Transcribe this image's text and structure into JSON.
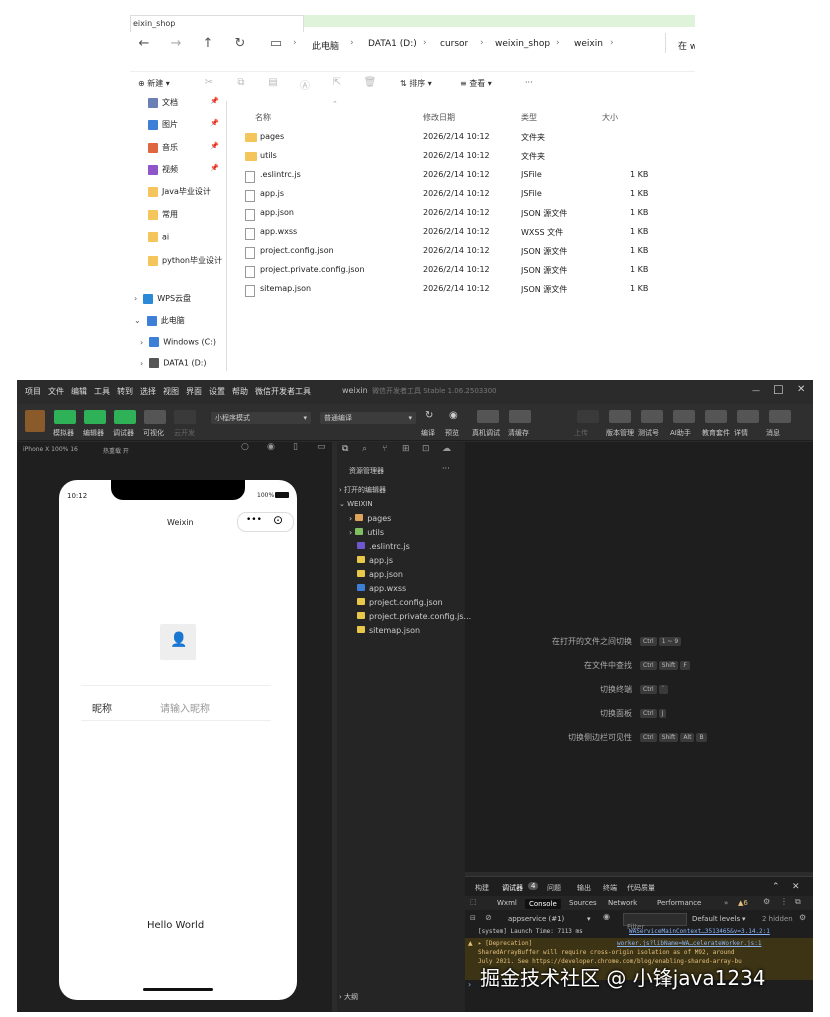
{
  "explorer": {
    "tab_title": "eixin_shop",
    "breadcrumb": [
      "此电脑",
      "DATA1 (D:)",
      "cursor",
      "weixin_shop",
      "weixin"
    ],
    "search_placeholder": "在 w",
    "toolbar": {
      "new": "新建",
      "sort": "排序",
      "view": "查看",
      "more": "···"
    },
    "sidebar": [
      {
        "label": "文档",
        "color": "#6a7fb5"
      },
      {
        "label": "图片",
        "color": "#3d7fd6"
      },
      {
        "label": "音乐",
        "color": "#e0663f"
      },
      {
        "label": "视频",
        "color": "#8f56c9"
      },
      {
        "label": "Java毕业设计",
        "color": "#f4c55b"
      },
      {
        "label": "常用",
        "color": "#f4c55b"
      },
      {
        "label": "ai",
        "color": "#f4c55b"
      },
      {
        "label": "python毕业设计",
        "color": "#f4c55b"
      }
    ],
    "tree": [
      {
        "label": "WPS云盘"
      },
      {
        "label": "此电脑"
      },
      {
        "label": "Windows (C:)"
      },
      {
        "label": "DATA1 (D:)"
      }
    ],
    "columns": [
      "名称",
      "修改日期",
      "类型",
      "大小"
    ],
    "files": [
      {
        "name": "pages",
        "date": "2026/2/14 10:12",
        "type": "文件夹",
        "size": "",
        "kind": "folder"
      },
      {
        "name": "utils",
        "date": "2026/2/14 10:12",
        "type": "文件夹",
        "size": "",
        "kind": "folder"
      },
      {
        "name": ".eslintrc.js",
        "date": "2026/2/14 10:12",
        "type": "JSFile",
        "size": "1 KB",
        "kind": "file"
      },
      {
        "name": "app.js",
        "date": "2026/2/14 10:12",
        "type": "JSFile",
        "size": "1 KB",
        "kind": "file"
      },
      {
        "name": "app.json",
        "date": "2026/2/14 10:12",
        "type": "JSON 源文件",
        "size": "1 KB",
        "kind": "file"
      },
      {
        "name": "app.wxss",
        "date": "2026/2/14 10:12",
        "type": "WXSS 文件",
        "size": "1 KB",
        "kind": "file"
      },
      {
        "name": "project.config.json",
        "date": "2026/2/14 10:12",
        "type": "JSON 源文件",
        "size": "1 KB",
        "kind": "file"
      },
      {
        "name": "project.private.config.json",
        "date": "2026/2/14 10:12",
        "type": "JSON 源文件",
        "size": "1 KB",
        "kind": "file"
      },
      {
        "name": "sitemap.json",
        "date": "2026/2/14 10:12",
        "type": "JSON 源文件",
        "size": "1 KB",
        "kind": "file"
      }
    ]
  },
  "ide": {
    "menu": [
      "项目",
      "文件",
      "编辑",
      "工具",
      "转到",
      "选择",
      "视图",
      "界面",
      "设置",
      "帮助",
      "微信开发者工具"
    ],
    "title": "weixin",
    "subtitle": "微信开发者工具 Stable 1.06.2503300",
    "toolbar_left": [
      "模拟器",
      "编辑器",
      "调试器",
      "可视化",
      "云开发"
    ],
    "mode_select": "小程序模式",
    "compile_select": "普通编译",
    "toolbar_mid": [
      "编译",
      "预览",
      "真机调试",
      "清缓存"
    ],
    "toolbar_right": [
      "上传",
      "版本管理",
      "测试号",
      "AI助手",
      "教育套件",
      "详情",
      "消息"
    ],
    "device": "iPhone X 100% 16",
    "hotreload": "热重载 开",
    "phone": {
      "time": "10:12",
      "battery": "100%",
      "nav_title": "Weixin",
      "nickname_label": "昵称",
      "nickname_placeholder": "请输入昵称",
      "hello": "Hello World"
    },
    "files_panel": {
      "title": "资源管理器",
      "open_editors": "打开的编辑器",
      "root": "WEIXIN",
      "items": [
        {
          "name": "pages",
          "icon": "folder-icon",
          "color": "#e0a35b"
        },
        {
          "name": "utils",
          "icon": "folder-icon",
          "color": "#7fbf5f"
        },
        {
          "name": ".eslintrc.js",
          "icon": "eslint-icon",
          "color": "#6f57d1"
        },
        {
          "name": "app.js",
          "icon": "js-icon",
          "color": "#e8c84a"
        },
        {
          "name": "app.json",
          "icon": "json-icon",
          "color": "#e8c84a"
        },
        {
          "name": "app.wxss",
          "icon": "wxss-icon",
          "color": "#3d7fd6"
        },
        {
          "name": "project.config.json",
          "icon": "json-icon",
          "color": "#e8c84a"
        },
        {
          "name": "project.private.config.js...",
          "icon": "json-icon",
          "color": "#e8c84a"
        },
        {
          "name": "sitemap.json",
          "icon": "json-icon",
          "color": "#e8c84a"
        }
      ],
      "outline": "大纲"
    },
    "shortcuts": [
      {
        "label": "在打开的文件之间切换",
        "keys": [
          "Ctrl",
          "1 ~ 9"
        ]
      },
      {
        "label": "在文件中查找",
        "keys": [
          "Ctrl",
          "Shift",
          "F"
        ]
      },
      {
        "label": "切换终端",
        "keys": [
          "Ctrl",
          "`"
        ]
      },
      {
        "label": "切换面板",
        "keys": [
          "Ctrl",
          "J"
        ]
      },
      {
        "label": "切换侧边栏可见性",
        "keys": [
          "Ctrl",
          "Shift",
          "Alt",
          "B"
        ]
      }
    ],
    "panel_tabs": [
      "构建",
      "调试器",
      "问题",
      "输出",
      "终端",
      "代码质量"
    ],
    "debugger_count": "4",
    "devtools_tabs": [
      "Wxml",
      "Console",
      "Sources",
      "Network",
      "Performance"
    ],
    "warn_count": "6",
    "context": "appservice (#1)",
    "filter_placeholder": "Filter",
    "levels": "Default levels",
    "hidden": "2 hidden",
    "log_lines": [
      "[system] Launch Time: 7113 ms",
      "▸ [Deprecation]",
      "SharedArrayBuffer will require cross-origin isolation as of M92, around",
      "July 2021. See https://developer.chrome.com/blog/enabling-shared-array-bu"
    ],
    "log_source1": "WAServiceMainContext…3513465&v=3.14.2:1",
    "log_source2": "worker.js?libName=WA…celerateWorker.js:1"
  },
  "watermark": "掘金技术社区 @ 小锋java1234"
}
